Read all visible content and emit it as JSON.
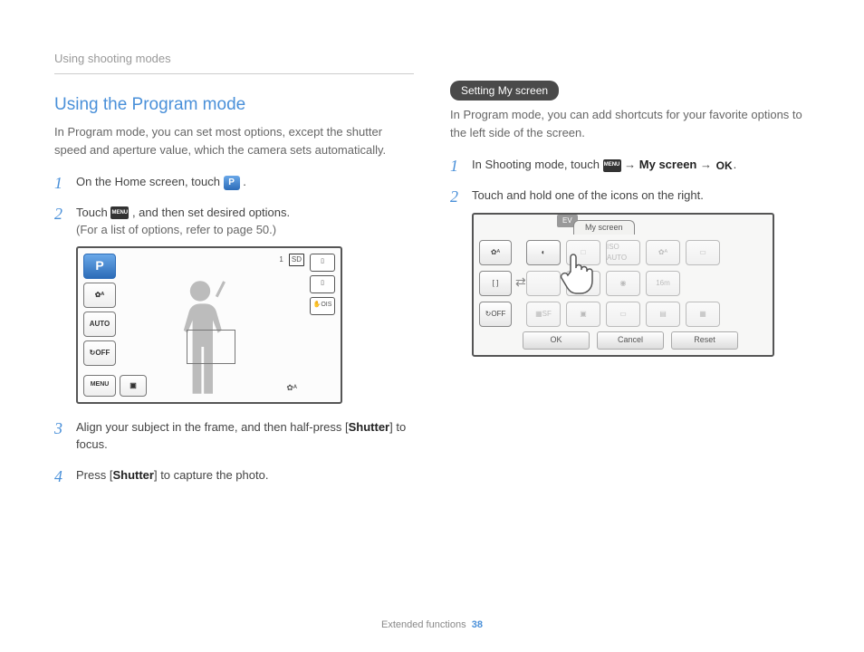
{
  "header": {
    "breadcrumb": "Using shooting modes"
  },
  "left": {
    "title": "Using the Program mode",
    "intro": "In Program mode, you can set most options, except the shutter speed and aperture value, which the camera sets automatically.",
    "steps": [
      {
        "pre": "On the Home screen, touch ",
        "post": "."
      },
      {
        "pre": "Touch ",
        "mid": ", and then set desired options.",
        "sub": "(For a list of options, refer to page 50.)"
      },
      {
        "pre": "Align your subject in the frame, and then half-press [",
        "bold": "Shutter",
        "post": "] to focus."
      },
      {
        "pre": "Press [",
        "bold": "Shutter",
        "post": "] to capture the photo."
      }
    ],
    "cam": {
      "p": "P",
      "sidebar": [
        "✿ᴬ",
        "AUTO",
        "↻OFF"
      ],
      "menu": "MENU",
      "topCount": "1",
      "rightChips": [
        "▯",
        "▯",
        "✋OIS"
      ],
      "bottomRight": "✿ᴬ"
    }
  },
  "right": {
    "pill": "Setting My screen",
    "intro": "In Program mode, you can add shortcuts for your favorite options to the left side of the screen.",
    "steps": [
      {
        "pre": "In Shooting mode, touch ",
        "arrow1": " → ",
        "bold": "My screen",
        "arrow2": " → ",
        "post": "."
      },
      {
        "text": "Touch and hold one of the icons on the right."
      }
    ],
    "shot2": {
      "evTip": "EV",
      "tabActive": "My screen",
      "left": [
        "✿ᴬ",
        "[ ]",
        "↻OFF"
      ],
      "grid": [
        "◐",
        "□",
        "ISO AUTO",
        "✿ᴬ",
        "▭",
        " ",
        "[ ]",
        "◉",
        "16m",
        "▦SF",
        "▣",
        "▭",
        "▤",
        "▦"
      ],
      "actions": [
        "OK",
        "Cancel",
        "Reset"
      ]
    }
  },
  "footer": {
    "label": "Extended functions",
    "page": "38"
  }
}
